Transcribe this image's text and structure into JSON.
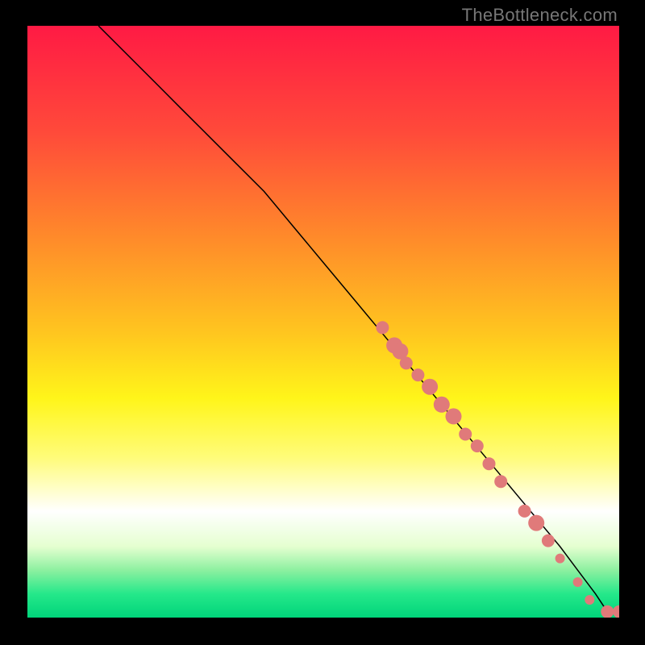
{
  "watermark": "TheBottleneck.com",
  "chart_data": {
    "type": "line",
    "title": "",
    "xlabel": "",
    "ylabel": "",
    "xlim": [
      0,
      100
    ],
    "ylim": [
      0,
      100
    ],
    "grid": false,
    "legend": false,
    "series": [
      {
        "name": "curve",
        "style": {
          "stroke": "#000000",
          "width": 1.5
        },
        "x": [
          12,
          15,
          18,
          22,
          26,
          30,
          35,
          40,
          45,
          50,
          55,
          60,
          65,
          70,
          75,
          80,
          85,
          90,
          93,
          96,
          98,
          100
        ],
        "y": [
          100,
          97,
          94,
          90,
          86,
          82,
          77,
          72,
          66,
          60,
          54,
          48,
          42,
          36,
          30,
          24,
          18,
          12,
          8,
          4,
          1,
          1
        ]
      },
      {
        "name": "points",
        "style": {
          "fill": "#e07a7a",
          "radius_small": 6,
          "radius_large": 10
        },
        "points": [
          {
            "x": 60,
            "y": 49,
            "r": 8
          },
          {
            "x": 62,
            "y": 46,
            "r": 10
          },
          {
            "x": 63,
            "y": 45,
            "r": 10
          },
          {
            "x": 64,
            "y": 43,
            "r": 8
          },
          {
            "x": 66,
            "y": 41,
            "r": 8
          },
          {
            "x": 68,
            "y": 39,
            "r": 10
          },
          {
            "x": 70,
            "y": 36,
            "r": 10
          },
          {
            "x": 72,
            "y": 34,
            "r": 10
          },
          {
            "x": 74,
            "y": 31,
            "r": 8
          },
          {
            "x": 76,
            "y": 29,
            "r": 8
          },
          {
            "x": 78,
            "y": 26,
            "r": 8
          },
          {
            "x": 80,
            "y": 23,
            "r": 8
          },
          {
            "x": 84,
            "y": 18,
            "r": 8
          },
          {
            "x": 86,
            "y": 16,
            "r": 10
          },
          {
            "x": 88,
            "y": 13,
            "r": 8
          },
          {
            "x": 90,
            "y": 10,
            "r": 6
          },
          {
            "x": 93,
            "y": 6,
            "r": 6
          },
          {
            "x": 95,
            "y": 3,
            "r": 6
          },
          {
            "x": 98,
            "y": 1,
            "r": 8
          },
          {
            "x": 100,
            "y": 1,
            "r": 8
          }
        ]
      }
    ]
  }
}
